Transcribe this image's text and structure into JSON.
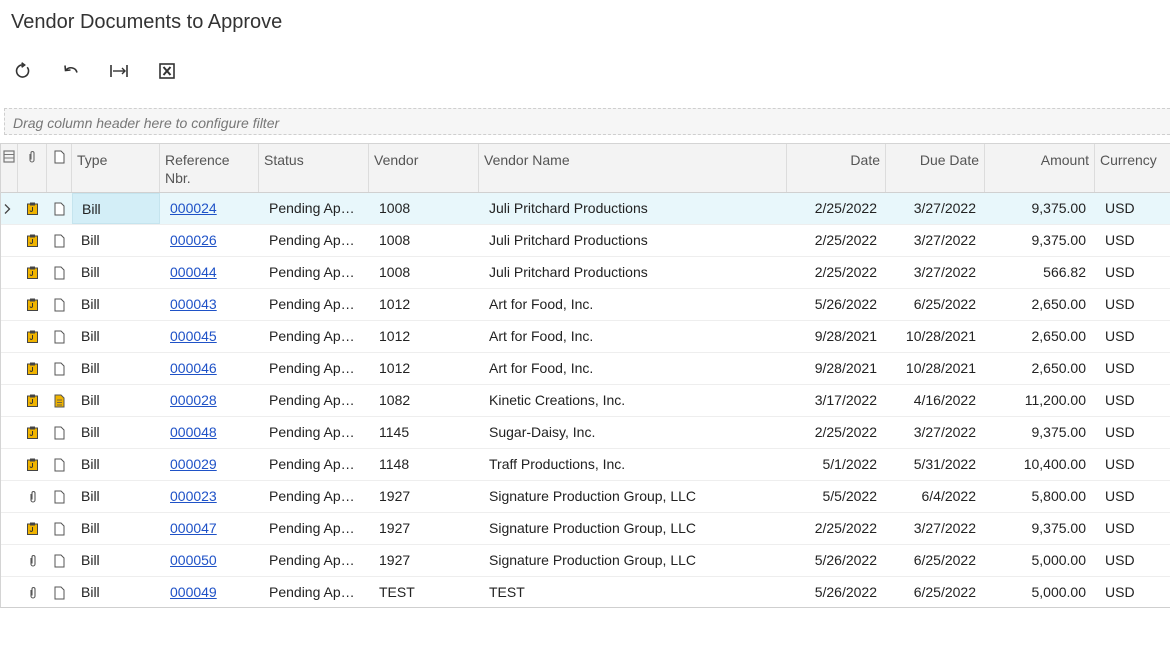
{
  "page": {
    "title": "Vendor Documents to Approve"
  },
  "toolbar": {
    "buttons": [
      {
        "name": "refresh-button",
        "icon": "refresh-icon"
      },
      {
        "name": "undo-button",
        "icon": "undo-icon"
      },
      {
        "name": "fit-columns-button",
        "icon": "fit-width-icon"
      },
      {
        "name": "export-excel-button",
        "icon": "excel-icon"
      }
    ]
  },
  "filter": {
    "placeholder": "Drag column header here to configure filter"
  },
  "grid": {
    "columns": {
      "type": "Type",
      "ref_nbr": "Reference Nbr.",
      "status": "Status",
      "vendor": "Vendor",
      "vendor_name": "Vendor Name",
      "date": "Date",
      "due_date": "Due Date",
      "amount": "Amount",
      "currency": "Currency"
    },
    "colors": {
      "selected_row": "#e8f7fb",
      "link": "#1f52c7",
      "approval_icon": "#f0b400"
    },
    "rows": [
      {
        "selected": true,
        "icon": "approval-clipboard-icon",
        "note": "note-empty-icon",
        "type": "Bill",
        "ref": "000024",
        "status": "Pending Ap…",
        "vendor": "1008",
        "vendor_name": "Juli Pritchard Productions",
        "date": "2/25/2022",
        "due_date": "3/27/2022",
        "amount": "9,375.00",
        "currency": "USD"
      },
      {
        "selected": false,
        "icon": "approval-clipboard-icon",
        "note": "note-empty-icon",
        "type": "Bill",
        "ref": "000026",
        "status": "Pending Ap…",
        "vendor": "1008",
        "vendor_name": "Juli Pritchard Productions",
        "date": "2/25/2022",
        "due_date": "3/27/2022",
        "amount": "9,375.00",
        "currency": "USD"
      },
      {
        "selected": false,
        "icon": "approval-clipboard-icon",
        "note": "note-empty-icon",
        "type": "Bill",
        "ref": "000044",
        "status": "Pending Ap…",
        "vendor": "1008",
        "vendor_name": "Juli Pritchard Productions",
        "date": "2/25/2022",
        "due_date": "3/27/2022",
        "amount": "566.82",
        "currency": "USD"
      },
      {
        "selected": false,
        "icon": "approval-clipboard-icon",
        "note": "note-empty-icon",
        "type": "Bill",
        "ref": "000043",
        "status": "Pending Ap…",
        "vendor": "1012",
        "vendor_name": "Art for Food, Inc.",
        "date": "5/26/2022",
        "due_date": "6/25/2022",
        "amount": "2,650.00",
        "currency": "USD"
      },
      {
        "selected": false,
        "icon": "approval-clipboard-icon",
        "note": "note-empty-icon",
        "type": "Bill",
        "ref": "000045",
        "status": "Pending Ap…",
        "vendor": "1012",
        "vendor_name": "Art for Food, Inc.",
        "date": "9/28/2021",
        "due_date": "10/28/2021",
        "amount": "2,650.00",
        "currency": "USD"
      },
      {
        "selected": false,
        "icon": "approval-clipboard-icon",
        "note": "note-empty-icon",
        "type": "Bill",
        "ref": "000046",
        "status": "Pending Ap…",
        "vendor": "1012",
        "vendor_name": "Art for Food, Inc.",
        "date": "9/28/2021",
        "due_date": "10/28/2021",
        "amount": "2,650.00",
        "currency": "USD"
      },
      {
        "selected": false,
        "icon": "approval-clipboard-icon",
        "note": "note-filled-icon",
        "type": "Bill",
        "ref": "000028",
        "status": "Pending Ap…",
        "vendor": "1082",
        "vendor_name": "Kinetic Creations, Inc.",
        "date": "3/17/2022",
        "due_date": "4/16/2022",
        "amount": "11,200.00",
        "currency": "USD"
      },
      {
        "selected": false,
        "icon": "approval-clipboard-icon",
        "note": "note-empty-icon",
        "type": "Bill",
        "ref": "000048",
        "status": "Pending Ap…",
        "vendor": "1145",
        "vendor_name": "Sugar-Daisy, Inc.",
        "date": "2/25/2022",
        "due_date": "3/27/2022",
        "amount": "9,375.00",
        "currency": "USD"
      },
      {
        "selected": false,
        "icon": "approval-clipboard-icon",
        "note": "note-empty-icon",
        "type": "Bill",
        "ref": "000029",
        "status": "Pending Ap…",
        "vendor": "1148",
        "vendor_name": "Traff Productions, Inc.",
        "date": "5/1/2022",
        "due_date": "5/31/2022",
        "amount": "10,400.00",
        "currency": "USD"
      },
      {
        "selected": false,
        "icon": "paperclip-icon",
        "note": "note-empty-icon",
        "type": "Bill",
        "ref": "000023",
        "status": "Pending Ap…",
        "vendor": "1927",
        "vendor_name": "Signature Production Group, LLC",
        "date": "5/5/2022",
        "due_date": "6/4/2022",
        "amount": "5,800.00",
        "currency": "USD"
      },
      {
        "selected": false,
        "icon": "approval-clipboard-icon",
        "note": "note-empty-icon",
        "type": "Bill",
        "ref": "000047",
        "status": "Pending Ap…",
        "vendor": "1927",
        "vendor_name": "Signature Production Group, LLC",
        "date": "2/25/2022",
        "due_date": "3/27/2022",
        "amount": "9,375.00",
        "currency": "USD"
      },
      {
        "selected": false,
        "icon": "paperclip-icon",
        "note": "note-empty-icon",
        "type": "Bill",
        "ref": "000050",
        "status": "Pending Ap…",
        "vendor": "1927",
        "vendor_name": "Signature Production Group, LLC",
        "date": "5/26/2022",
        "due_date": "6/25/2022",
        "amount": "5,000.00",
        "currency": "USD"
      },
      {
        "selected": false,
        "icon": "paperclip-icon",
        "note": "note-empty-icon",
        "type": "Bill",
        "ref": "000049",
        "status": "Pending Ap…",
        "vendor": "TEST",
        "vendor_name": "TEST",
        "date": "5/26/2022",
        "due_date": "6/25/2022",
        "amount": "5,000.00",
        "currency": "USD"
      }
    ]
  }
}
